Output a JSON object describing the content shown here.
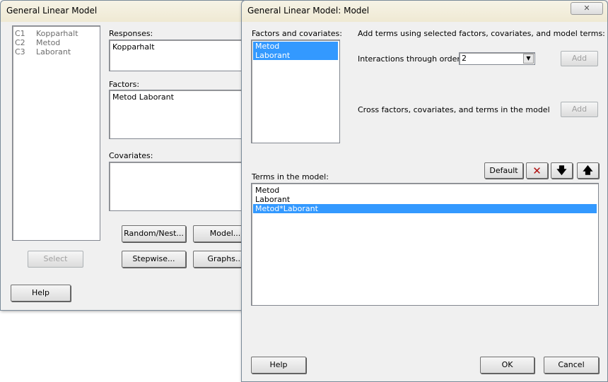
{
  "glm": {
    "title": "General Linear Model",
    "columns": [
      {
        "id": "C1",
        "name": "Kopparhalt"
      },
      {
        "id": "C2",
        "name": "Metod"
      },
      {
        "id": "C3",
        "name": "Laborant"
      }
    ],
    "responses_label": "Responses:",
    "responses_value": "Kopparhalt",
    "factors_label": "Factors:",
    "factors_value": "Metod Laborant",
    "covariates_label": "Covariates:",
    "covariates_value": "",
    "buttons": {
      "random": "Random/Nest...",
      "model": "Model...",
      "select": "Select",
      "stepwise": "Stepwise...",
      "graphs": "Graphs...",
      "help": "Help"
    }
  },
  "model": {
    "title": "General Linear Model: Model",
    "close": "✕",
    "factors_label": "Factors and covariates:",
    "factors": [
      "Metod",
      "Laborant"
    ],
    "add_terms_text": "Add terms using selected factors, covariates, and model terms:",
    "interactions_label": "Interactions through order:",
    "interactions_value": "2",
    "add": "Add",
    "cross_text": "Cross factors, covariates, and terms in the model",
    "default": "Default",
    "terms_label": "Terms in the model:",
    "terms": [
      "Metod",
      "Laborant",
      "Metod*Laborant"
    ],
    "help": "Help",
    "ok": "OK",
    "cancel": "Cancel"
  }
}
